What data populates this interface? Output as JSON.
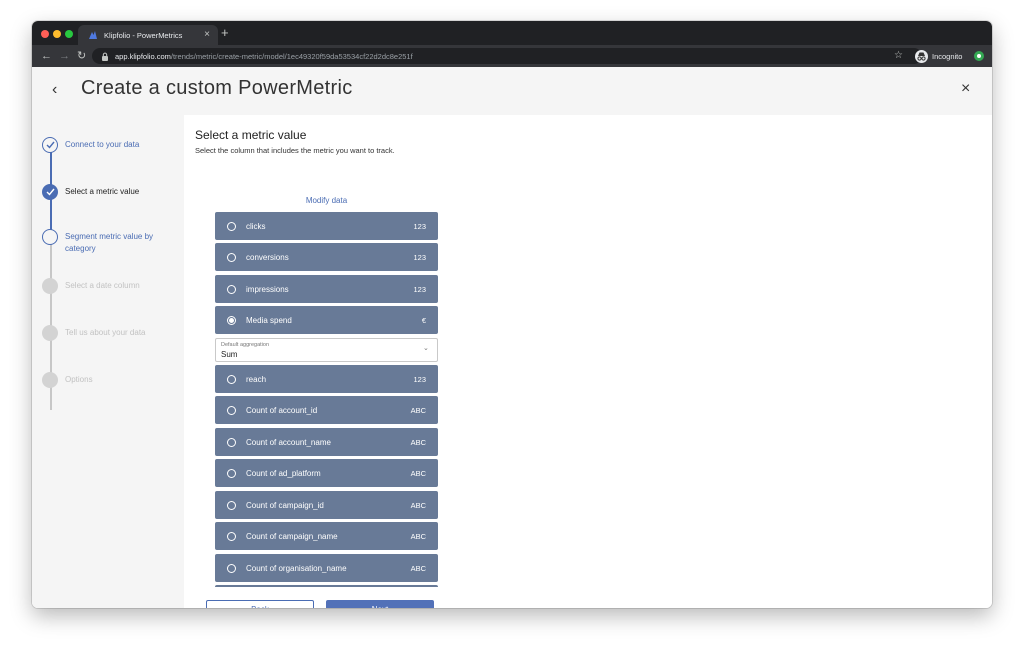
{
  "browser": {
    "tab_title": "Klipfolio - PowerMetrics",
    "tab_close": "×",
    "new_tab": "+",
    "url_host": "app.klipfolio.com",
    "url_path": "/trends/metric/create-metric/model/1ec49320f59da53534cf22d2dc8e251f",
    "incognito_label": "Incognito"
  },
  "header": {
    "back_glyph": "‹",
    "title": "Create a custom PowerMetric",
    "close_glyph": "×"
  },
  "steps": [
    {
      "label": "Connect to your data",
      "state": "done"
    },
    {
      "label": "Select a metric value",
      "state": "current"
    },
    {
      "label": "Segment metric value by category",
      "state": "next"
    },
    {
      "label": "Select a date column",
      "state": "disabled"
    },
    {
      "label": "Tell us about your data",
      "state": "disabled"
    },
    {
      "label": "Options",
      "state": "disabled"
    }
  ],
  "main": {
    "title": "Select a metric value",
    "subtitle": "Select the column that includes the metric you want to track.",
    "modify_link": "Modify data",
    "columns": [
      {
        "label": "clicks",
        "type": "123",
        "selected": false
      },
      {
        "label": "conversions",
        "type": "123",
        "selected": false
      },
      {
        "label": "impressions",
        "type": "123",
        "selected": false
      },
      {
        "label": "Media spend",
        "type": "€",
        "selected": true
      },
      {
        "label": "reach",
        "type": "123",
        "selected": false
      },
      {
        "label": "Count of account_id",
        "type": "ABC",
        "selected": false
      },
      {
        "label": "Count of account_name",
        "type": "ABC",
        "selected": false
      },
      {
        "label": "Count of ad_platform",
        "type": "ABC",
        "selected": false
      },
      {
        "label": "Count of campaign_id",
        "type": "ABC",
        "selected": false
      },
      {
        "label": "Count of campaign_name",
        "type": "ABC",
        "selected": false
      },
      {
        "label": "Count of organisation_name",
        "type": "ABC",
        "selected": false
      },
      {
        "label": "",
        "type": "",
        "selected": false
      }
    ],
    "aggregation": {
      "label": "Default aggregation",
      "value": "Sum"
    },
    "back_label": "Back",
    "next_label": "Next"
  },
  "colors": {
    "accent": "#4a6cb3",
    "row": "#687a97",
    "sidebar": "#f5f5f5"
  }
}
